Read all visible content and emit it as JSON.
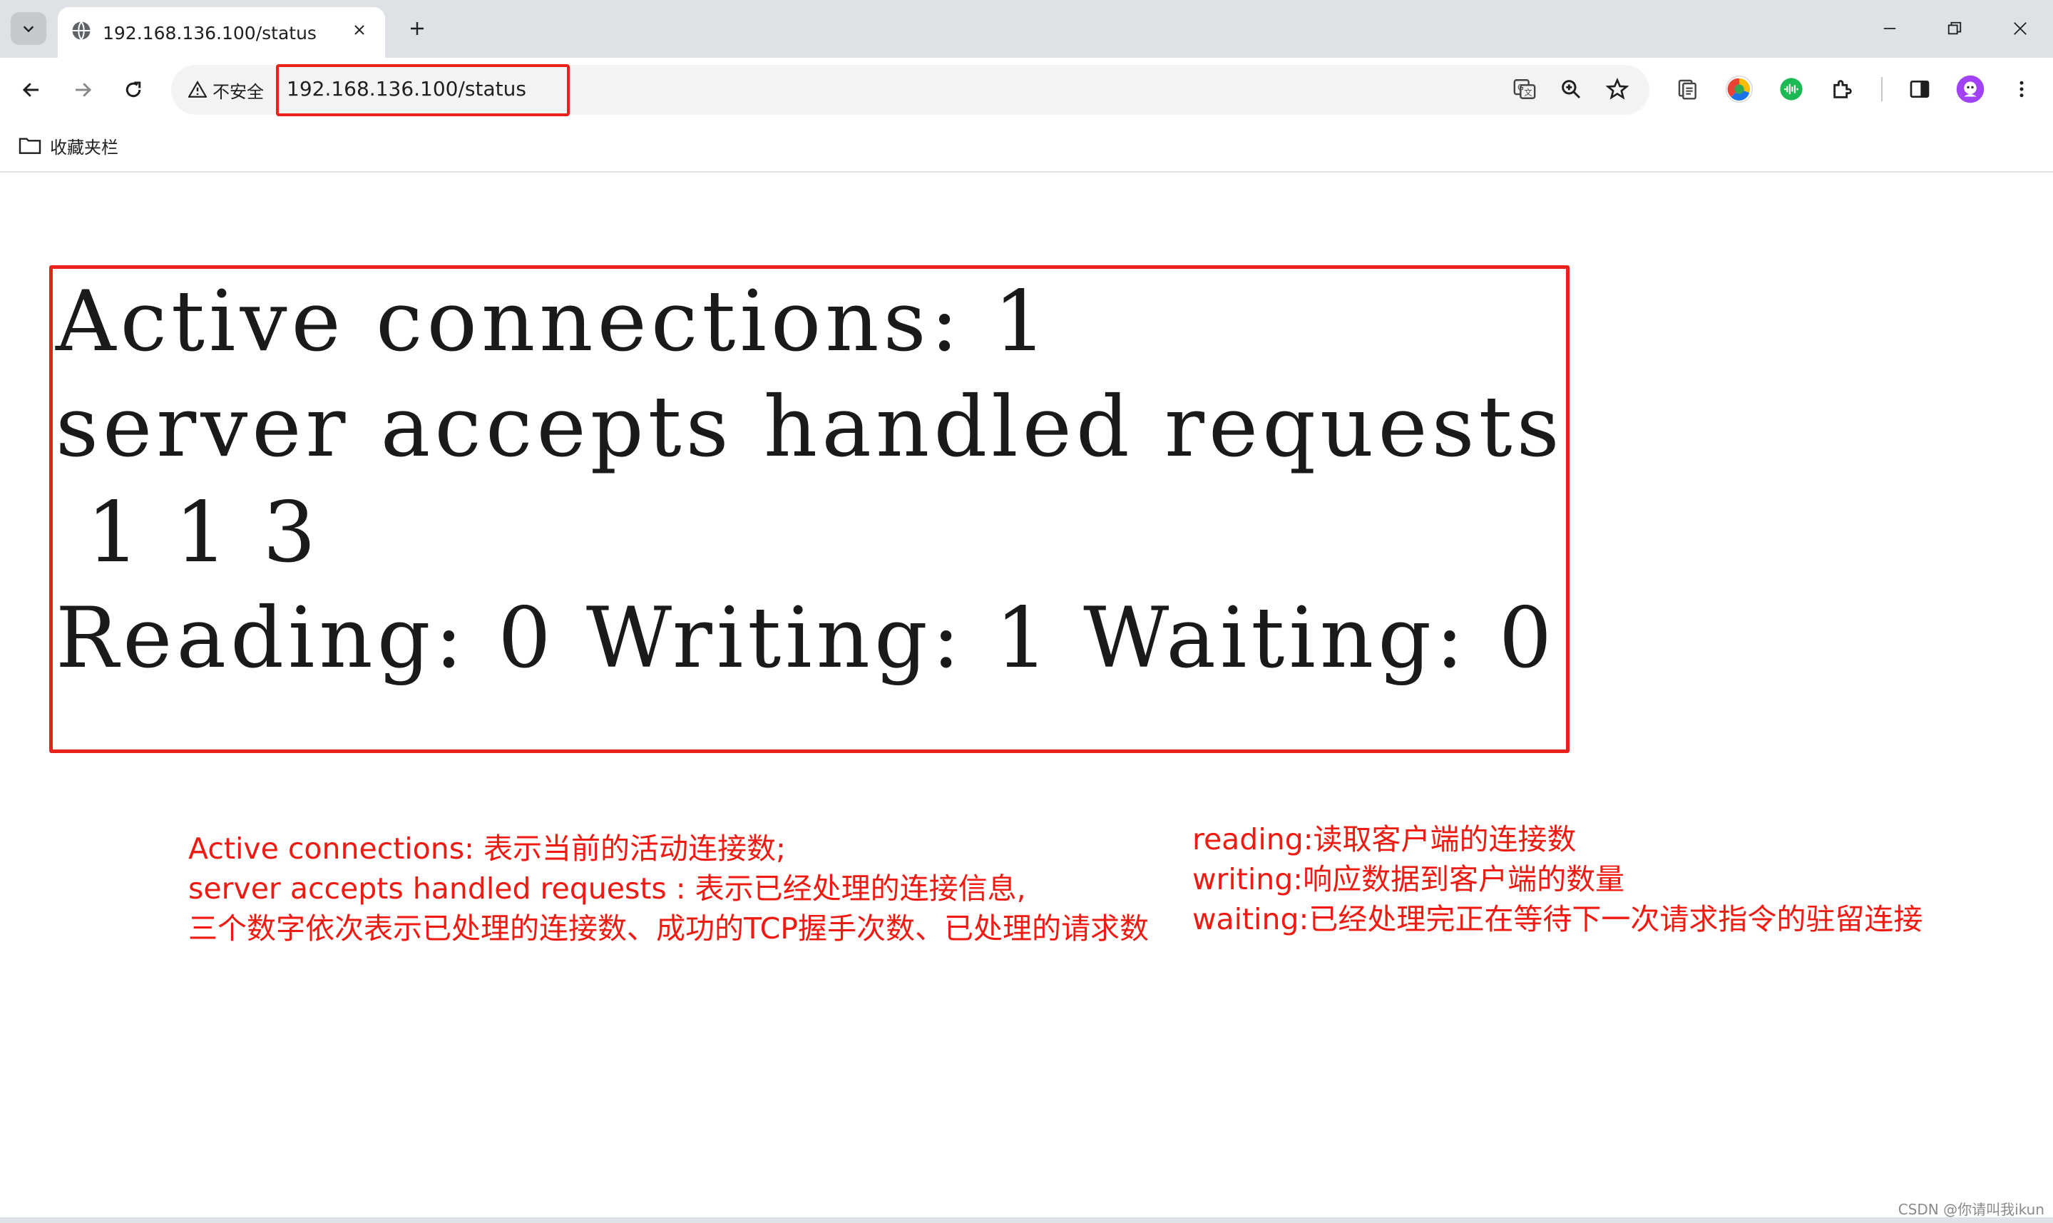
{
  "tab": {
    "title": "192.168.136.100/status"
  },
  "toolbar": {
    "security_label": "不安全",
    "url": "192.168.136.100/status"
  },
  "bookmarks": {
    "folder_label": "收藏夹栏"
  },
  "status": {
    "line1": "Active connections: 1",
    "line2": "server accepts handled requests",
    "line3": " 1 1 3",
    "line4": "Reading: 0 Writing: 1 Waiting: 0"
  },
  "notes_left": [
    "Active connections: 表示当前的活动连接数;",
    "server accepts handled requests : 表示已经处理的连接信息,",
    "三个数字依次表示已处理的连接数、成功的TCP握手次数、已处理的请求数"
  ],
  "notes_right": [
    "reading:读取客户端的连接数",
    "writing:响应数据到客户端的数量",
    "waiting:已经处理完正在等待下一次请求指令的驻留连接"
  ],
  "watermark": "CSDN @你请叫我ikun",
  "colors": {
    "annotation_red": "#e8211b",
    "tabstrip_bg": "#dee1e6",
    "omnibox_bg": "#f1f3f4"
  },
  "icons": [
    "tab-search-icon",
    "globe-icon",
    "close-icon",
    "plus-icon",
    "minimize-icon",
    "restore-icon",
    "back-icon",
    "forward-icon",
    "reload-icon",
    "warning-icon",
    "translate-icon",
    "zoom-icon",
    "star-icon",
    "reading-list-icon",
    "color-ball-icon",
    "audio-icon",
    "puzzle-icon",
    "side-panel-icon",
    "profile-avatar-icon",
    "more-icon",
    "folder-icon"
  ]
}
